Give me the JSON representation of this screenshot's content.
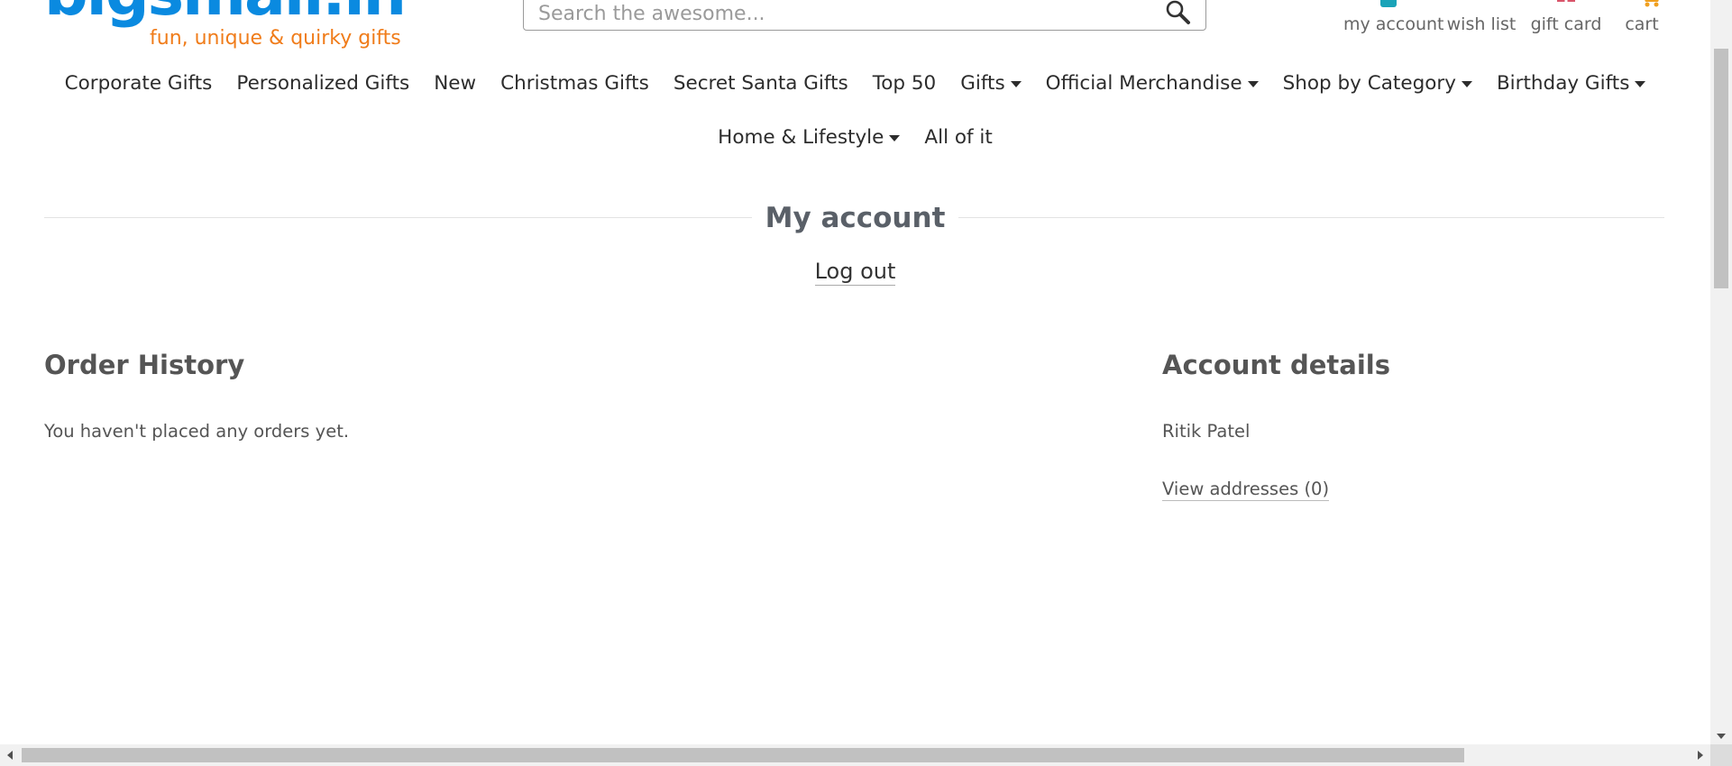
{
  "header": {
    "logo_text": "bigsmall.in",
    "logo_tagline": "fun, unique & quirky gifts",
    "search": {
      "placeholder": "Search the awesome...",
      "value": ""
    },
    "account_links": [
      {
        "label": "my account",
        "icon": "user-icon"
      },
      {
        "label": "wish list",
        "icon": "heart-icon"
      },
      {
        "label": "gift card",
        "icon": "gift-icon"
      },
      {
        "label": "cart",
        "icon": "cart-icon"
      }
    ]
  },
  "nav": {
    "row1": [
      {
        "label": "Corporate Gifts",
        "dropdown": false
      },
      {
        "label": "Personalized Gifts",
        "dropdown": false
      },
      {
        "label": "New",
        "dropdown": false
      },
      {
        "label": "Christmas Gifts",
        "dropdown": false
      },
      {
        "label": "Secret Santa Gifts",
        "dropdown": false
      },
      {
        "label": "Top 50",
        "dropdown": false
      },
      {
        "label": "Gifts",
        "dropdown": true
      },
      {
        "label": "Official Merchandise",
        "dropdown": true
      },
      {
        "label": "Shop by Category",
        "dropdown": true
      },
      {
        "label": "Birthday Gifts",
        "dropdown": true
      }
    ],
    "row2": [
      {
        "label": "Home & Lifestyle",
        "dropdown": true
      },
      {
        "label": "All of it",
        "dropdown": false
      }
    ]
  },
  "main": {
    "title": "My account",
    "logout_label": "Log out",
    "order_history": {
      "heading": "Order History",
      "empty_text": "You haven't placed any orders yet."
    },
    "account_details": {
      "heading": "Account details",
      "name": "Ritik Patel",
      "addresses_link": "View addresses (0)"
    }
  },
  "colors": {
    "logo_blue": "#0a8ae0",
    "logo_orange": "#f07c1a",
    "title_gray": "#5a6068",
    "user_icon_teal": "#1aa3b8",
    "heart_pink": "#d9546a"
  }
}
